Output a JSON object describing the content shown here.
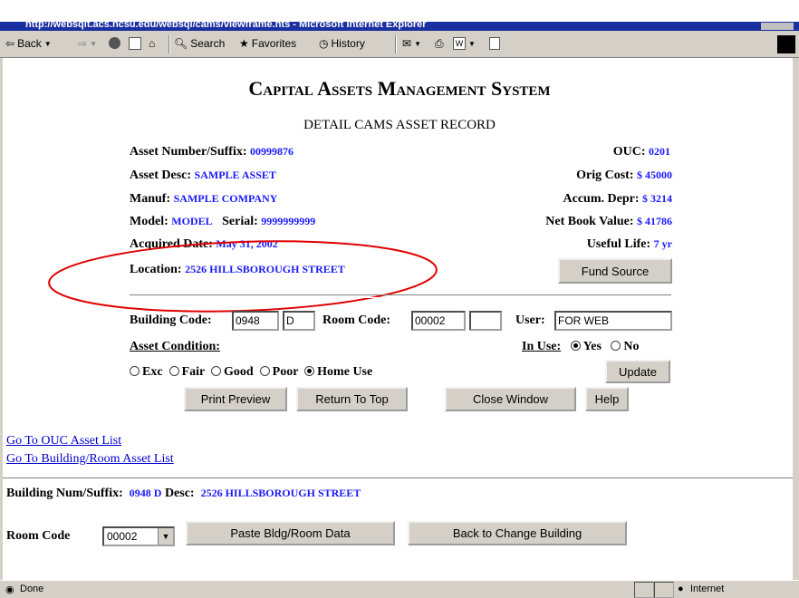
{
  "browser": {
    "title": "http://websqlt.acs.ncsu.edu/websql/cams/viewframe.hts - Microsoft Internet Explorer",
    "toolbar": {
      "back": "Back",
      "search": "Search",
      "favorites": "Favorites",
      "history": "History"
    },
    "status": {
      "done": "Done",
      "zone": "Internet"
    }
  },
  "page": {
    "title": "Capital Assets Management System",
    "subtitle": "DETAIL CAMS ASSET RECORD"
  },
  "asset": {
    "number_label": "Asset Number/Suffix:",
    "number": "00999876",
    "desc_label": "Asset Desc:",
    "desc": "SAMPLE ASSET",
    "manuf_label": "Manuf:",
    "manuf": "SAMPLE COMPANY",
    "model_label": "Model:",
    "model": "MODEL",
    "serial_label": "Serial:",
    "serial": "9999999999",
    "acquired_label": "Acquired Date:",
    "acquired": "May 31, 2002",
    "location_label": "Location:",
    "location": "2526 HILLSBOROUGH STREET",
    "ouc_label": "OUC:",
    "ouc": "0201",
    "orig_cost_label": "Orig Cost:",
    "orig_cost": "$ 45000",
    "accum_label": "Accum. Depr:",
    "accum": "$ 3214",
    "nbv_label": "Net Book Value:",
    "nbv": "$ 41786",
    "life_label": "Useful Life:",
    "life": "7 yr"
  },
  "form": {
    "fund_source": "Fund Source",
    "building_label": "Building Code:",
    "building_code": "0948",
    "building_suffix": "D",
    "room_label": "Room Code:",
    "room_code": "00002",
    "room_suffix": "",
    "user_label": "User:",
    "user": "FOR WEB",
    "condition_label": "Asset Condition:",
    "in_use_label": "In Use:",
    "yes": "Yes",
    "no": "No",
    "conditions": [
      "Exc",
      "Fair",
      "Good",
      "Poor",
      "Home Use"
    ],
    "selected_condition": "Home Use",
    "update": "Update"
  },
  "actions": {
    "print": "Print Preview",
    "top": "Return To Top",
    "close": "Close Window",
    "help": "Help"
  },
  "links": {
    "ouc_list": "Go To OUC Asset List",
    "bldg_list": "Go To Building/Room Asset List"
  },
  "lower": {
    "bldg_num_label": "Building Num/Suffix:",
    "bldg_num": "0948 D",
    "desc_label": "Desc:",
    "desc": "2526 HILLSBOROUGH STREET",
    "room_label": "Room Code",
    "room_value": "00002",
    "paste": "Paste Bldg/Room Data",
    "back_change": "Back to Change Building"
  },
  "colors": {
    "highlight": "#e00000",
    "value_blue": "#1a1aff"
  }
}
